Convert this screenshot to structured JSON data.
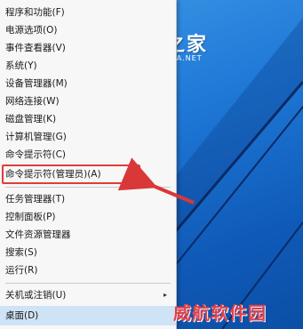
{
  "menu": {
    "items": [
      {
        "label": "程序和功能(F)"
      },
      {
        "label": "电源选项(O)"
      },
      {
        "label": "事件查看器(V)"
      },
      {
        "label": "系统(Y)"
      },
      {
        "label": "设备管理器(M)"
      },
      {
        "label": "网络连接(W)"
      },
      {
        "label": "磁盘管理(K)"
      },
      {
        "label": "计算机管理(G)"
      },
      {
        "label": "命令提示符(C)"
      },
      {
        "label": "命令提示符(管理员)(A)"
      },
      {
        "label": "任务管理器(T)"
      },
      {
        "label": "控制面板(P)"
      },
      {
        "label": "文件资源管理器"
      },
      {
        "label": "搜索(S)"
      },
      {
        "label": "运行(R)"
      },
      {
        "label": "关机或注销(U)"
      },
      {
        "label": "桌面(D)"
      }
    ],
    "submenu_arrow": "▸"
  },
  "logo": {
    "name": "系统之家",
    "url_text": "XITONGZHIJIA.NET"
  },
  "watermark": "威航软件园",
  "colors": {
    "highlight_border": "#e23b3b",
    "arrow": "#d93838",
    "desktop_blue": "#1f78d6"
  }
}
